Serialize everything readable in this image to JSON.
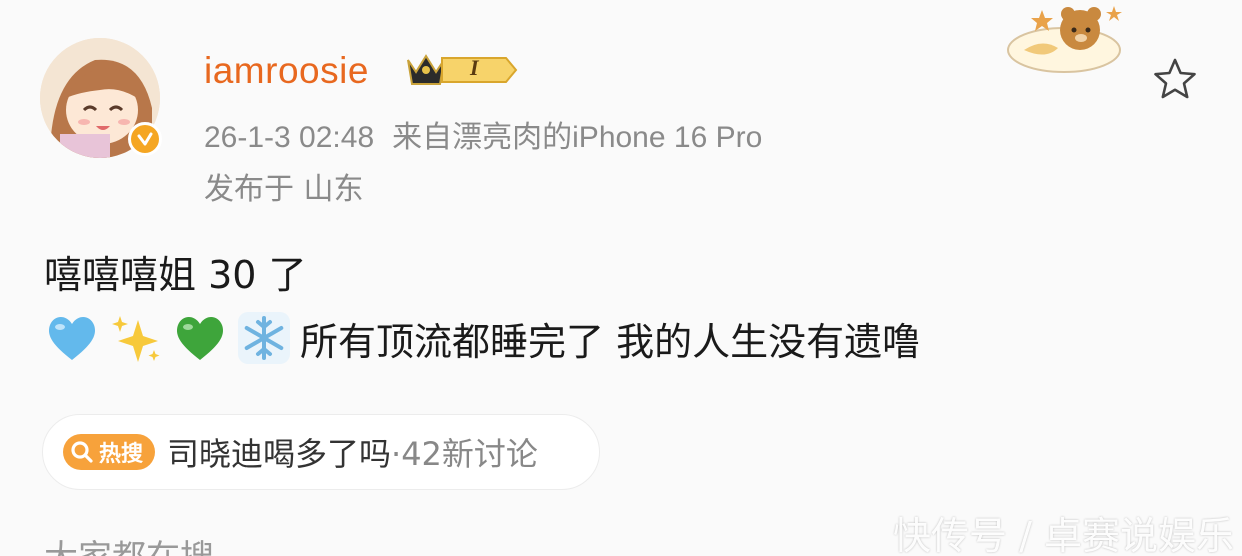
{
  "post": {
    "username": "iamroosie",
    "level_badge": "I",
    "timestamp": "26-1-3 02:48",
    "source": "来自漂亮肉的iPhone 16 Pro",
    "location": "发布于 山东",
    "text_line1": "嘻嘻嘻姐 30 了",
    "text_line2": "所有顶流都睡完了 我的人生没有遗噜",
    "emojis": [
      "blue-heart",
      "sparkles",
      "green-heart",
      "snowflake"
    ]
  },
  "hot_search": {
    "badge_label": "热搜",
    "topic": "司晓迪喝多了吗",
    "count_text": "·42新讨论"
  },
  "search_hint": "大家都在搜",
  "watermark": "快传号 / 卓赛说娱乐",
  "colors": {
    "username": "#e8681f",
    "meta_gray": "#8a8a8a",
    "hot_badge": "#f7a23b",
    "verified": "#f5a623"
  }
}
